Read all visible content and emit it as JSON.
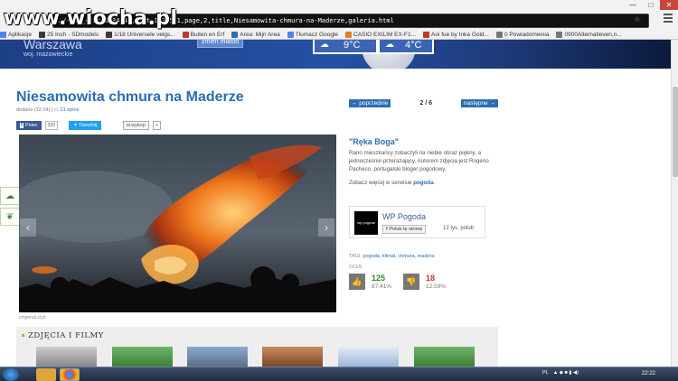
{
  "watermark": "www.wiocha.pl",
  "address": "…/-/45_4,bc,1834548,list,1835571,page,2,title,Niesamowita-chmura-na-Maderze,galeria.html",
  "window": {
    "min": "—",
    "max": "□",
    "close": "✕"
  },
  "bookmarks": [
    {
      "label": "Aplikacje",
      "color": "#4a86e8"
    },
    {
      "label": "25 Inch - SDmodels",
      "color": "#3a3a3a"
    },
    {
      "label": "1/18 Universele velgs...",
      "color": "#3a3a3a"
    },
    {
      "label": "Buiten en Erf",
      "color": "#c0392b"
    },
    {
      "label": "Area: Mijn Area",
      "color": "#2c6db3"
    },
    {
      "label": "Tłumacz Google",
      "color": "#4a86e8"
    },
    {
      "label": "CASIO EXILIM EX-F1...",
      "color": "#e67e22"
    },
    {
      "label": "Aoi fue by Inka Gold...",
      "color": "#c0392b"
    },
    {
      "label": "0 Powiadomienia",
      "color": "#777777"
    },
    {
      "label": "0900Alternatieven.n...",
      "color": "#777777"
    }
  ],
  "banner": {
    "city": "Warszawa",
    "region": "woj. mazowieckie",
    "button": "zmień miasto",
    "temp1": "9°C",
    "temp2": "4°C"
  },
  "article": {
    "title": "Niesamowita chmura na Maderze",
    "meta_prefix": "dodane (12:24)  |",
    "comments": "21 opinii",
    "fb_label": "Polec",
    "fb_count": "325",
    "tweet": "Tweetnij",
    "wykop": "wykop",
    "wykop_plus": "+",
    "photo_source": "cmjornal.xl.pt"
  },
  "gallery": {
    "prev": "← poprzednie",
    "position": "2 / 6",
    "next": "następne →",
    "subtitle": "\"Ręka Boga\"",
    "description": "Rano mieszkańcy zobaczyli na niebie obraz piękny, a jednocześnie przerażający. Autorem zdjęcia jest Rogerio Pacheco, portugalski bloger pogodowy.",
    "more_prefix": "Zobacz więcej w serwisie ",
    "more_link": "pogoda",
    "more_suffix": "."
  },
  "fbbox": {
    "logo": "wp pogoda",
    "name": "WP Pogoda",
    "like": "Polub tę stronę",
    "likes": "12 tys. polub"
  },
  "tags": {
    "label": "TAGI: ",
    "items": "pogoda, klimat, chmura, madera"
  },
  "rating": {
    "label": "OCEŃ",
    "up_count": "125",
    "up_pct": "87.41%",
    "down_count": "18",
    "down_pct": "12.59%",
    "up_color": "#2e8b2e",
    "down_color": "#c0392b"
  },
  "films": {
    "title": "ZDJĘCIA I FILMY"
  },
  "taskbar": {
    "lang": "PL",
    "time": "22:22"
  }
}
